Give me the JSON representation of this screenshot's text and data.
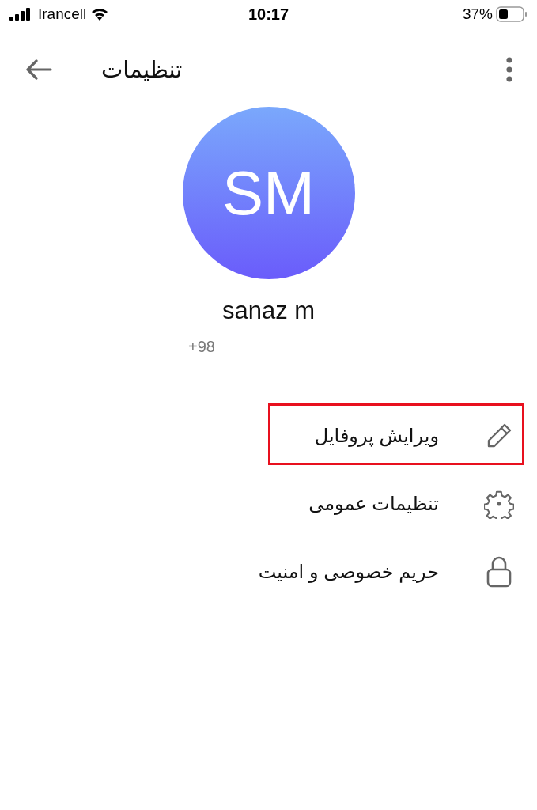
{
  "status_bar": {
    "carrier": "Irancell",
    "time": "10:17",
    "battery": "37%"
  },
  "app_bar": {
    "title": "تنظیمات"
  },
  "profile": {
    "initials": "SM",
    "name": "sanaz m",
    "phone": "+98"
  },
  "menu": [
    {
      "kind": "edit",
      "label": "ویرایش پروفایل",
      "highlighted": true
    },
    {
      "kind": "settings",
      "label": "تنظیمات عمومی",
      "highlighted": false
    },
    {
      "kind": "lock",
      "label": "حریم خصوصی و امنیت",
      "highlighted": false
    }
  ]
}
